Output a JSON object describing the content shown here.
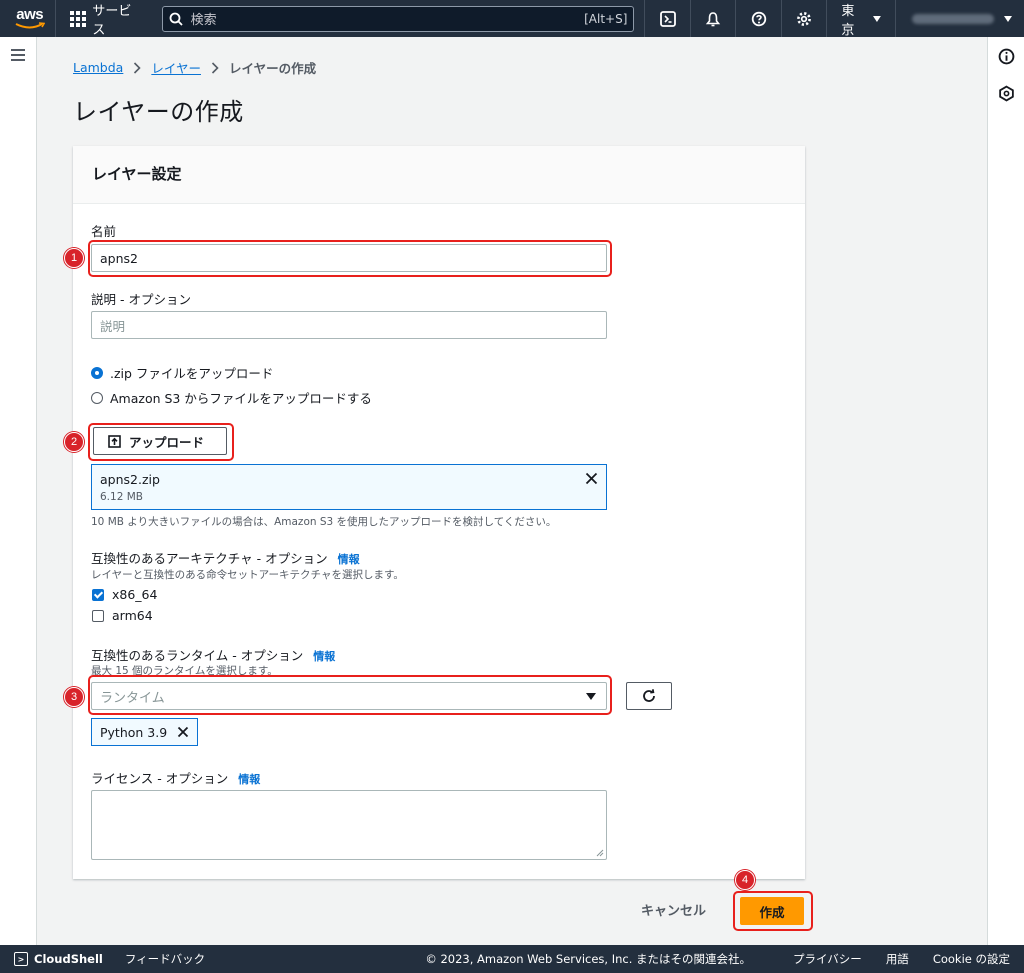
{
  "topnav": {
    "logo_text": "aws",
    "services_label": "サービス",
    "search_placeholder": "検索",
    "search_shortcut": "[Alt+S]",
    "region_label": "東京"
  },
  "breadcrumb": {
    "items": [
      "Lambda",
      "レイヤー"
    ],
    "current": "レイヤーの作成"
  },
  "page_title": "レイヤーの作成",
  "panel": {
    "header": "レイヤー設定",
    "name_label": "名前",
    "name_value": "apns2",
    "desc_label": "説明 - オプション",
    "desc_placeholder": "説明",
    "radio_zip": ".zip ファイルをアップロード",
    "radio_s3": "Amazon S3 からファイルをアップロードする",
    "upload_button": "アップロード",
    "file_name": "apns2.zip",
    "file_size": "6.12 MB",
    "file_hint": "10 MB より大きいファイルの場合は、Amazon S3 を使用したアップロードを検討してください。",
    "arch_label": "互換性のあるアーキテクチャ - オプション",
    "arch_info": "情報",
    "arch_desc": "レイヤーと互換性のある命令セットアーキテクチャを選択します。",
    "arch_options": [
      {
        "label": "x86_64",
        "checked": true
      },
      {
        "label": "arm64",
        "checked": false
      }
    ],
    "runtime_label": "互換性のあるランタイム - オプション",
    "runtime_info": "情報",
    "runtime_desc": "最大 15 個のランタイムを選択します。",
    "runtime_placeholder": "ランタイム",
    "runtime_token": "Python 3.9",
    "license_label": "ライセンス - オプション",
    "license_info": "情報"
  },
  "actions": {
    "cancel": "キャンセル",
    "create": "作成"
  },
  "annotations": [
    "1",
    "2",
    "3",
    "4"
  ],
  "footer": {
    "cloudshell": "CloudShell",
    "feedback": "フィードバック",
    "copyright": "© 2023, Amazon Web Services, Inc. またはその関連会社。",
    "privacy": "プライバシー",
    "terms": "用語",
    "cookie": "Cookie の設定"
  },
  "colors": {
    "nav_bg": "#232f3e",
    "link": "#0972d3",
    "primary_button": "#ff9900",
    "annotation_red": "#e8201c"
  }
}
